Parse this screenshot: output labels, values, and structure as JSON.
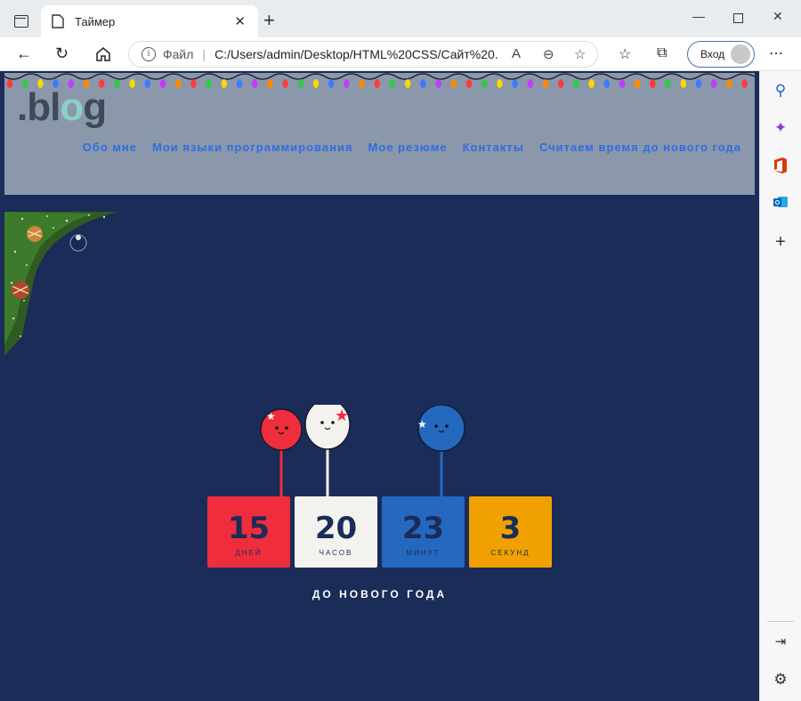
{
  "browser": {
    "tab_title": "Таймер",
    "url_protocol_label": "Файл",
    "url": "C:/Users/admin/Desktop/HTML%20CSS/Сайт%20...",
    "signin_label": "Вход"
  },
  "site": {
    "logo_prefix": ".bl",
    "logo_o": "o",
    "logo_suffix": "g",
    "nav": [
      "Обо мне",
      "Мои языки программирования",
      "Мое резюме",
      "Контакты",
      "Считаем время до нового года"
    ]
  },
  "countdown": {
    "items": [
      {
        "value": "15",
        "label": "ДНЕЙ",
        "color": "#ef2d3c"
      },
      {
        "value": "20",
        "label": "ЧАСОВ",
        "color": "#f4f2ee"
      },
      {
        "value": "23",
        "label": "МИНУТ",
        "color": "#2568c0"
      },
      {
        "value": "3",
        "label": "СЕКУНД",
        "color": "#f0a000"
      }
    ],
    "caption": "ДО НОВОГО ГОДА"
  },
  "colors": {
    "page_bg": "#1a2c57",
    "header_bg": "#8b97ab",
    "nav_link": "#2d6fe0"
  }
}
